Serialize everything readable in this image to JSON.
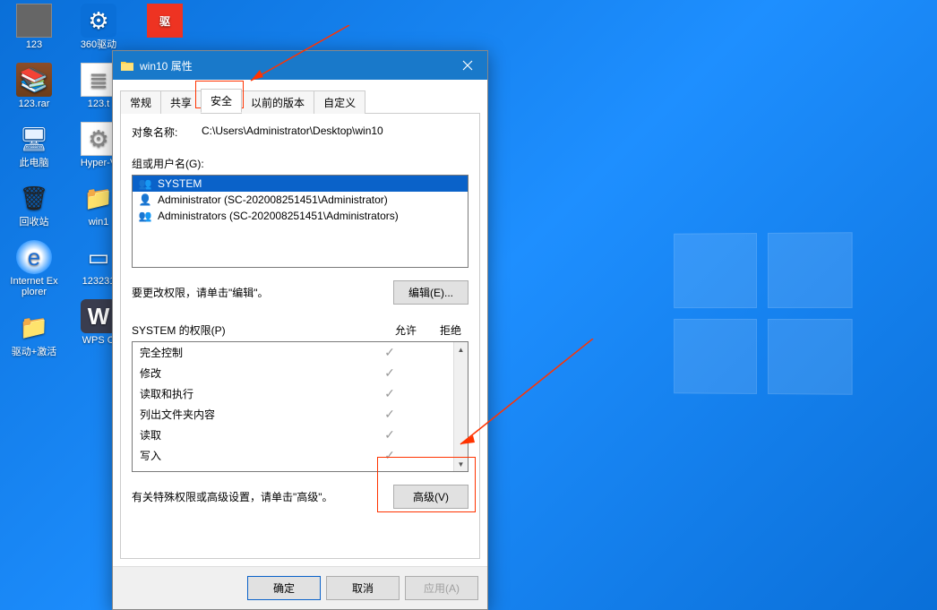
{
  "desktop": {
    "col1": [
      {
        "label": "123",
        "icon": "ico-123",
        "glyph": ""
      },
      {
        "label": "123.rar",
        "icon": "ico-rar",
        "glyph": "📚"
      },
      {
        "label": "此电脑",
        "icon": "ico-pc",
        "glyph": "🖥"
      },
      {
        "label": "回收站",
        "icon": "ico-bin",
        "glyph": "🗑"
      },
      {
        "label": "Internet Explorer",
        "icon": "ico-ie",
        "glyph": "e"
      },
      {
        "label": "驱动+激活",
        "icon": "ico-folder",
        "glyph": "📁"
      }
    ],
    "col2": [
      {
        "label": "360驱动",
        "icon": "ico-blue",
        "glyph": "⚙"
      },
      {
        "label": "123.t",
        "icon": "ico-txt",
        "glyph": "≣"
      },
      {
        "label": "Hyper-V",
        "icon": "ico-txt",
        "glyph": "⚙"
      },
      {
        "label": "win1",
        "icon": "ico-folder",
        "glyph": "📁"
      },
      {
        "label": "123231",
        "icon": "",
        "glyph": "▭"
      },
      {
        "label": "WPS O",
        "icon": "ico-wps",
        "glyph": "W"
      }
    ],
    "col3_top": {
      "label": "",
      "icon": "ico-red",
      "glyph": "驱"
    }
  },
  "dialog": {
    "title": "win10 属性",
    "tabs": [
      "常规",
      "共享",
      "安全",
      "以前的版本",
      "自定义"
    ],
    "active_tab": 2,
    "object_label": "对象名称:",
    "object_value": "C:\\Users\\Administrator\\Desktop\\win10",
    "users_label": "组或用户名(G):",
    "users": [
      {
        "name": "SYSTEM",
        "icon": "👥",
        "selected": true
      },
      {
        "name": "Administrator (SC-202008251451\\Administrator)",
        "icon": "👤",
        "selected": false
      },
      {
        "name": "Administrators (SC-202008251451\\Administrators)",
        "icon": "👥",
        "selected": false
      }
    ],
    "edit_hint": "要更改权限，请单击\"编辑\"。",
    "edit_btn": "编辑(E)...",
    "perm_header": "SYSTEM 的权限(P)",
    "perm_allow": "允许",
    "perm_deny": "拒绝",
    "permissions": [
      {
        "name": "完全控制",
        "allow": true,
        "deny": false
      },
      {
        "name": "修改",
        "allow": true,
        "deny": false
      },
      {
        "name": "读取和执行",
        "allow": true,
        "deny": false
      },
      {
        "name": "列出文件夹内容",
        "allow": true,
        "deny": false
      },
      {
        "name": "读取",
        "allow": true,
        "deny": false
      },
      {
        "name": "写入",
        "allow": true,
        "deny": false
      }
    ],
    "adv_hint": "有关特殊权限或高级设置，请单击\"高级\"。",
    "adv_btn": "高级(V)",
    "ok_btn": "确定",
    "cancel_btn": "取消",
    "apply_btn": "应用(A)"
  }
}
